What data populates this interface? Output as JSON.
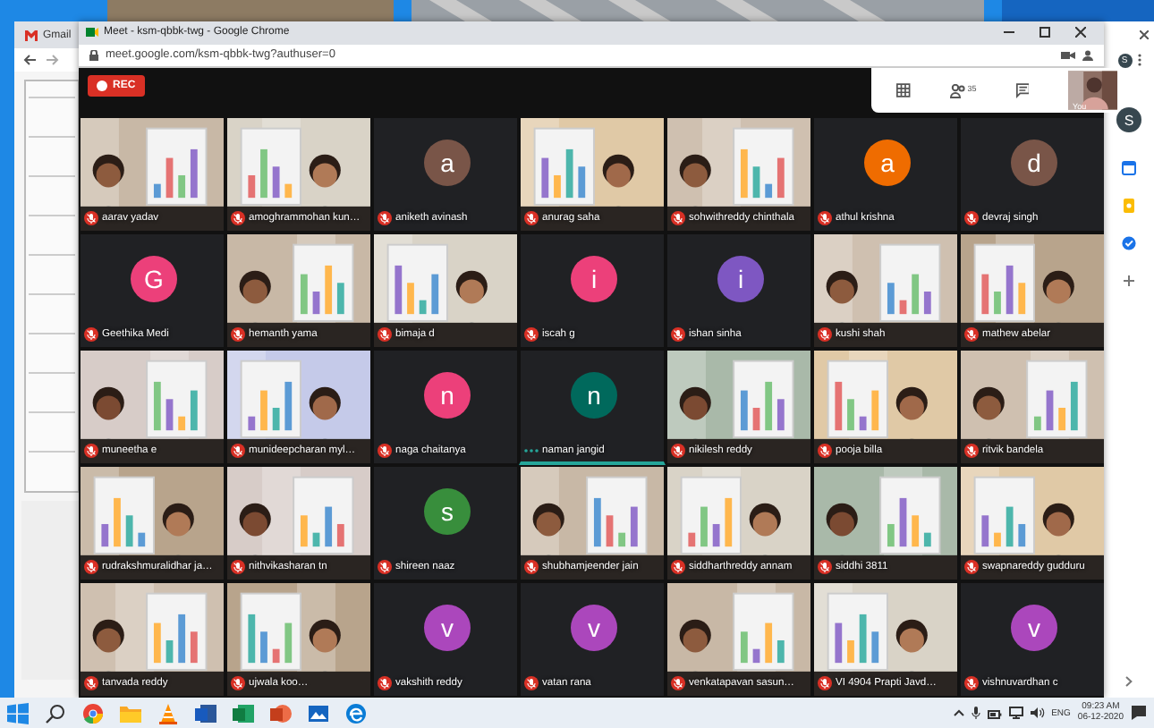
{
  "back_window": {
    "tab": {
      "label": "Gmail"
    },
    "account_small": "S",
    "account": "S"
  },
  "meet_window": {
    "title": "Meet - ksm-qbbk-twg - Google Chrome",
    "url": "meet.google.com/ksm-qbbk-twg?authuser=0",
    "rec": "REC",
    "participants_count": "35",
    "self_label": "You",
    "tiles": [
      {
        "name": "aarav yadav",
        "kind": "video",
        "muted": true,
        "speaking": false
      },
      {
        "name": "amoghrammohan kun…",
        "kind": "video",
        "muted": true,
        "speaking": false
      },
      {
        "name": "aniketh avinash",
        "kind": "avatar",
        "initial": "a",
        "color": "#795548",
        "muted": true,
        "speaking": false
      },
      {
        "name": "anurag saha",
        "kind": "video",
        "muted": true,
        "speaking": false
      },
      {
        "name": "sohwithreddy chinthala",
        "kind": "video",
        "muted": true,
        "speaking": false
      },
      {
        "name": "athul krishna",
        "kind": "avatar",
        "initial": "a",
        "color": "#ef6c00",
        "muted": true,
        "speaking": false
      },
      {
        "name": "devraj singh",
        "kind": "avatar",
        "initial": "d",
        "color": "#795548",
        "muted": true,
        "speaking": false
      },
      {
        "name": "Geethika Medi",
        "kind": "avatar",
        "initial": "G",
        "color": "#ec407a",
        "muted": true,
        "speaking": false
      },
      {
        "name": "hemanth yama",
        "kind": "video",
        "muted": true,
        "speaking": false
      },
      {
        "name": "bimaja d",
        "kind": "video",
        "muted": true,
        "speaking": false
      },
      {
        "name": "iscah g",
        "kind": "avatar",
        "initial": "i",
        "color": "#ec407a",
        "muted": true,
        "speaking": false
      },
      {
        "name": "ishan sinha",
        "kind": "avatar",
        "initial": "i",
        "color": "#7e57c2",
        "muted": true,
        "speaking": false
      },
      {
        "name": "kushi shah",
        "kind": "video",
        "muted": true,
        "speaking": false
      },
      {
        "name": "mathew abelar",
        "kind": "video",
        "muted": true,
        "speaking": false
      },
      {
        "name": "muneetha e",
        "kind": "video",
        "muted": true,
        "speaking": false
      },
      {
        "name": "munideepcharan myl…",
        "kind": "video",
        "muted": true,
        "speaking": false
      },
      {
        "name": "naga chaitanya",
        "kind": "avatar",
        "initial": "n",
        "color": "#ec407a",
        "muted": true,
        "speaking": false
      },
      {
        "name": "naman jangid",
        "kind": "avatar",
        "initial": "n",
        "color": "#00695c",
        "muted": false,
        "speaking": true
      },
      {
        "name": "nikilesh reddy",
        "kind": "video",
        "muted": true,
        "speaking": false
      },
      {
        "name": "pooja billa",
        "kind": "video",
        "muted": true,
        "speaking": false
      },
      {
        "name": "ritvik bandela",
        "kind": "video",
        "muted": true,
        "speaking": false
      },
      {
        "name": "rudrakshmuralidhar ja…",
        "kind": "video",
        "muted": true,
        "speaking": false
      },
      {
        "name": "nithvikasharan tn",
        "kind": "video",
        "muted": true,
        "speaking": false
      },
      {
        "name": "shireen naaz",
        "kind": "avatar",
        "initial": "s",
        "color": "#388e3c",
        "muted": true,
        "speaking": false
      },
      {
        "name": "shubhamjeender jain",
        "kind": "video",
        "muted": true,
        "speaking": false
      },
      {
        "name": "siddharthreddy annam",
        "kind": "video",
        "muted": true,
        "speaking": false
      },
      {
        "name": "siddhi 3811",
        "kind": "video",
        "muted": true,
        "speaking": false
      },
      {
        "name": "swapnareddy gudduru",
        "kind": "video",
        "muted": true,
        "speaking": false
      },
      {
        "name": "tanvada reddy",
        "kind": "video",
        "muted": true,
        "speaking": false
      },
      {
        "name": "ujwala koo…",
        "kind": "video",
        "muted": true,
        "speaking": false
      },
      {
        "name": "vakshith reddy",
        "kind": "avatar",
        "initial": "v",
        "color": "#ab47bc",
        "muted": true,
        "speaking": false
      },
      {
        "name": "vatan rana",
        "kind": "avatar",
        "initial": "v",
        "color": "#ab47bc",
        "muted": true,
        "speaking": false
      },
      {
        "name": "venkatapavan sasun…",
        "kind": "video",
        "muted": true,
        "speaking": false
      },
      {
        "name": "VI 4904 Prapti Javd…",
        "kind": "video",
        "muted": true,
        "speaking": false
      },
      {
        "name": "vishnuvardhan c",
        "kind": "avatar",
        "initial": "v",
        "color": "#ab47bc",
        "muted": true,
        "speaking": false
      }
    ]
  },
  "taskbar": {
    "language": "ENG",
    "time": "09:23 AM",
    "date": "06-12-2020"
  }
}
